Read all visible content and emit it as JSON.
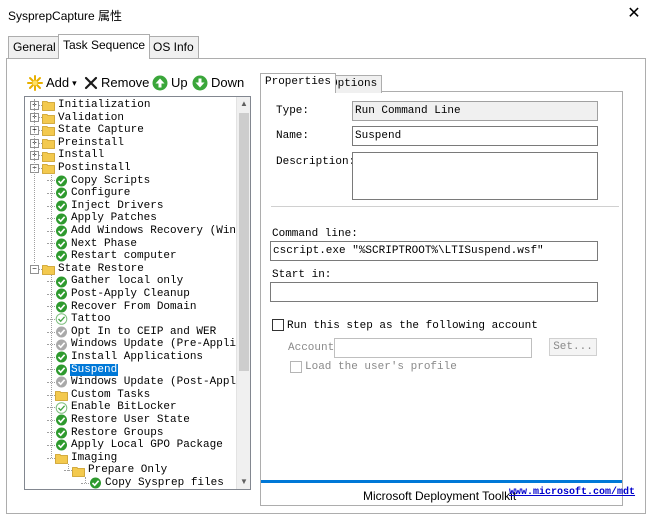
{
  "window": {
    "title": "SysprepCapture 属性",
    "close_glyph": "✕"
  },
  "outer_tabs": [
    {
      "label": "General"
    },
    {
      "label": "Task Sequence"
    },
    {
      "label": "OS Info"
    }
  ],
  "toolbar": {
    "add_label": "Add",
    "add_caret": "▾",
    "remove_label": "Remove",
    "up_label": "Up",
    "down_label": "Down"
  },
  "tree": {
    "scroll_up": "▲",
    "scroll_down": "▼",
    "items": [
      {
        "label": "Initialization",
        "level": 0,
        "type": "folder",
        "expander": "+"
      },
      {
        "label": "Validation",
        "level": 0,
        "type": "folder",
        "expander": "+"
      },
      {
        "label": "State Capture",
        "level": 0,
        "type": "folder",
        "expander": "+"
      },
      {
        "label": "Preinstall",
        "level": 0,
        "type": "folder",
        "expander": "+"
      },
      {
        "label": "Install",
        "level": 0,
        "type": "folder",
        "expander": "+"
      },
      {
        "label": "Postinstall",
        "level": 0,
        "type": "folder",
        "expander": "−"
      },
      {
        "label": "Copy Scripts",
        "level": 1,
        "type": "check"
      },
      {
        "label": "Configure",
        "level": 1,
        "type": "check"
      },
      {
        "label": "Inject Drivers",
        "level": 1,
        "type": "check"
      },
      {
        "label": "Apply Patches",
        "level": 1,
        "type": "check"
      },
      {
        "label": "Add Windows Recovery (WinRE)",
        "level": 1,
        "type": "check"
      },
      {
        "label": "Next Phase",
        "level": 1,
        "type": "check"
      },
      {
        "label": "Restart computer",
        "level": 1,
        "type": "check"
      },
      {
        "label": "State Restore",
        "level": 0,
        "type": "folder",
        "expander": "−"
      },
      {
        "label": "Gather local only",
        "level": 1,
        "type": "check"
      },
      {
        "label": "Post-Apply Cleanup",
        "level": 1,
        "type": "check"
      },
      {
        "label": "Recover From Domain",
        "level": 1,
        "type": "check"
      },
      {
        "label": "Tattoo",
        "level": 1,
        "type": "check-light"
      },
      {
        "label": "Opt In to CEIP and WER",
        "level": 1,
        "type": "check-gray"
      },
      {
        "label": "Windows Update (Pre-Application",
        "level": 1,
        "type": "check-gray"
      },
      {
        "label": "Install Applications",
        "level": 1,
        "type": "check"
      },
      {
        "label": "Suspend",
        "level": 1,
        "type": "check",
        "selected": true
      },
      {
        "label": "Windows Update (Post-Applicati",
        "level": 1,
        "type": "check-gray"
      },
      {
        "label": "Custom Tasks",
        "level": 1,
        "type": "folder"
      },
      {
        "label": "Enable BitLocker",
        "level": 1,
        "type": "check-light"
      },
      {
        "label": "Restore User State",
        "level": 1,
        "type": "check"
      },
      {
        "label": "Restore Groups",
        "level": 1,
        "type": "check"
      },
      {
        "label": "Apply Local GPO Package",
        "level": 1,
        "type": "check"
      },
      {
        "label": "Imaging",
        "level": 1,
        "type": "folder"
      },
      {
        "label": "Prepare Only",
        "level": 2,
        "type": "folder"
      },
      {
        "label": "Copy Sysprep files",
        "level": 3,
        "type": "check"
      }
    ]
  },
  "right_tabs": [
    {
      "label": "Properties"
    },
    {
      "label": "Options"
    }
  ],
  "properties": {
    "type_label": "Type:",
    "type_value": "Run Command Line",
    "name_label": "Name:",
    "name_value": "Suspend",
    "description_label": "Description:",
    "description_value": "",
    "command_line_label": "Command line:",
    "command_line_value": "cscript.exe \"%SCRIPTROOT%\\LTISuspend.wsf\"",
    "start_in_label": "Start in:",
    "start_in_value": "",
    "run_as_label": "Run this step as the following account",
    "account_label": "Account:",
    "account_value": "",
    "set_button": "Set...",
    "load_profile_label": "Load the user's profile"
  },
  "footer": {
    "brand": "Microsoft Deployment Toolkit",
    "link": "www.microsoft.com/mdt"
  }
}
